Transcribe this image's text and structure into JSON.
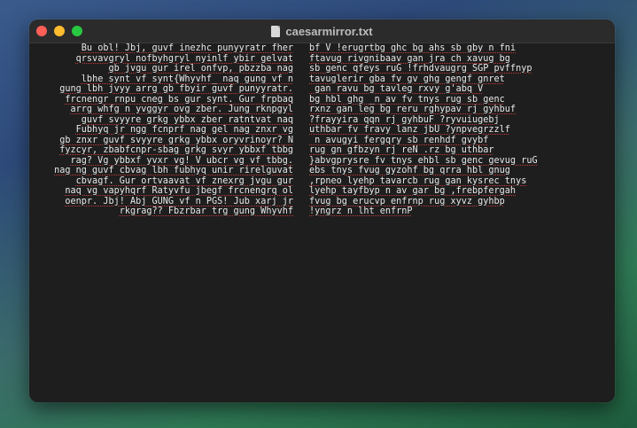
{
  "window": {
    "title": "caesarmirror.txt",
    "traffic_lights": [
      "close",
      "minimize",
      "maximize"
    ],
    "colors": {
      "close": "#ff5f57",
      "minimize": "#febc2e",
      "maximize": "#28c840",
      "background": "#1e1e1e",
      "text": "#e8e8e8"
    }
  },
  "document": {
    "left_lines": [
      "Bu obl! Jbj, guvf inezhc punyyratr fher",
      "qrsvavgryl nofbyhgryl nyinlf ybir gelvat",
      "gb jvgu gur irel onfvp, pbzzba nag",
      "lbhe synt vf synt{Whyvhf_ naq gung vf n",
      "gung lbh jvyy arrg gb fbyir guvf punyyratr.",
      "frcnengr rnpu cneg bs gur synt. Gur frpbaq",
      "arrg whfg n yvggyr ovg zber. Jung rknpgyl",
      "guvf svyyre grkg ybbx zber ratntvat naq",
      "Fubhyq jr ngg fcnprf nag gel nag znxr vg",
      "gb znxr guvf svyyre grkg ybbx oryvrinoyr? N",
      "fyzcyr, zbabfcnpr-sbag grkg svyr ybbxf tbbg",
      "rag? Vg ybbxf yvxr vg! V ubcr vg vf tbbg.",
      "nag ng guvf cbvag lbh fubhyq unir rirelguvat",
      "cbvagf. Gur ortvaavat vf znexrg jvgu gur",
      "naq vg vapyhqrf Ratyvfu jbegf frcnengrq ol",
      "oenpr. Jbj! Abj GUNG vf n PGS! Jub xarj jr",
      "rkgrag?? Fbzrbar trg gung Whyvhf"
    ],
    "right_lines": [
      "bf V !erugrtbg ghc bg ahs sb gby n fni",
      "ftavug rivgnibaav gan jra ch xavug bg",
      "sb genc qfeys ruG !frhdvaugrg SGP pvffnyp",
      "tavuglerir gba fv gv ghg gengf gnret",
      " gan ravu bg tavleg rxvy g'abq V",
      "bg hbl ghg _n_av fv tnys rug sb genc",
      "rxnz gan leg bg reru rghypav rj gyhbuf",
      "?frayyira qqn rj gyhbuF ?ryvuiugebj",
      "uthbar fv fravy lanz jbU ?ynpvegrzzlf",
      " n avugyi fergqry sb renhdf gvybf",
      "rug gn gfbzyn rj reN .rz bg uthbar",
      "}abvgprysre fv tnys ehbl sb genc gevug ruG",
      "ebs tnys fvug gyzohf bg qrra hbl gnug",
      ",rpneo lyehp tavarcb rug gan kysrec tnys",
      "lyehp tayfbyp n av gar bg ,frebpfergah",
      "fvug bg erucvp enfrnp rug xyvz gyhbp",
      "!yngrz n lht enfrnP"
    ]
  }
}
